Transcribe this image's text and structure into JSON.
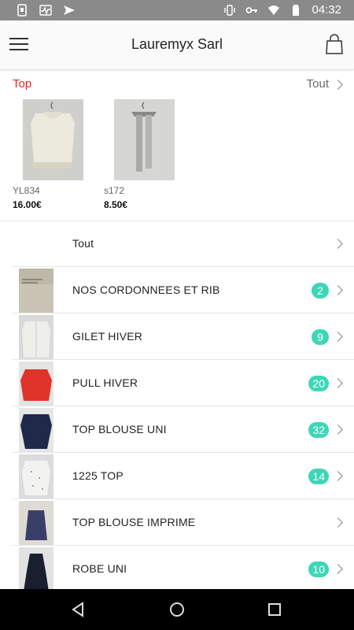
{
  "status_bar": {
    "time": "04:32"
  },
  "app_bar": {
    "title": "Lauremyx Sarl"
  },
  "featured": {
    "label": "Top",
    "see_all": "Tout",
    "products": [
      {
        "code": "YL834",
        "price": "16.00€"
      },
      {
        "code": "s172",
        "price": "8.50€"
      }
    ]
  },
  "categories": {
    "all_label": "Tout",
    "items": [
      {
        "name": "NOS CORDONNEES ET RIB",
        "count": "2"
      },
      {
        "name": "GILET HIVER",
        "count": "9"
      },
      {
        "name": "PULL HIVER",
        "count": "20"
      },
      {
        "name": "TOP  BLOUSE UNI",
        "count": "32"
      },
      {
        "name": "1225 TOP",
        "count": "14"
      },
      {
        "name": "TOP BLOUSE IMPRIME",
        "count": ""
      },
      {
        "name": "ROBE  UNI",
        "count": "10"
      }
    ]
  },
  "colors": {
    "accent_red": "#e32222",
    "badge_teal": "#3dd6b7"
  }
}
